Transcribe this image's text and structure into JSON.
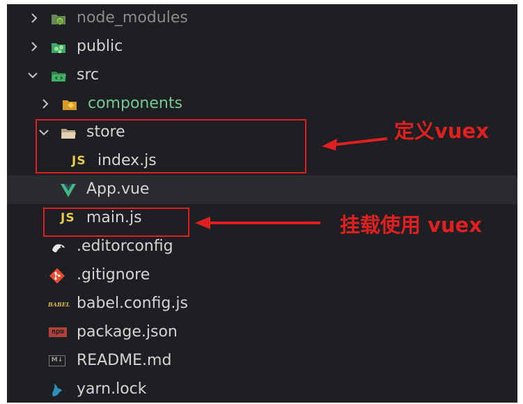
{
  "explorer": {
    "items": [
      {
        "label": "node_modules",
        "icon": "node-modules-folder-icon",
        "type": "folder",
        "expanded": false
      },
      {
        "label": "public",
        "icon": "public-folder-icon",
        "type": "folder",
        "expanded": false
      },
      {
        "label": "src",
        "icon": "src-folder-icon",
        "type": "folder",
        "expanded": true
      },
      {
        "label": "components",
        "icon": "components-folder-icon",
        "type": "folder",
        "expanded": false
      },
      {
        "label": "store",
        "icon": "folder-open-icon",
        "type": "folder",
        "expanded": true
      },
      {
        "label": "index.js",
        "icon": "js-file-icon",
        "icon_text": "JS",
        "type": "file"
      },
      {
        "label": "App.vue",
        "icon": "vue-file-icon",
        "type": "file"
      },
      {
        "label": "main.js",
        "icon": "js-file-icon",
        "icon_text": "JS",
        "type": "file"
      },
      {
        "label": ".editorconfig",
        "icon": "editorconfig-file-icon",
        "type": "file"
      },
      {
        "label": ".gitignore",
        "icon": "git-file-icon",
        "type": "file"
      },
      {
        "label": "babel.config.js",
        "icon": "babel-file-icon",
        "icon_text": "BABEL",
        "type": "file"
      },
      {
        "label": "package.json",
        "icon": "npm-file-icon",
        "icon_text": "npm",
        "type": "file"
      },
      {
        "label": "README.md",
        "icon": "markdown-file-icon",
        "icon_text": "M↓",
        "type": "file"
      },
      {
        "label": "yarn.lock",
        "icon": "yarn-file-icon",
        "type": "file"
      }
    ]
  },
  "annotations": {
    "define_vuex": "定义vuex",
    "mount_use_vuex": "挂载使用 vuex"
  },
  "colors": {
    "background": "#1e1f22",
    "text": "#d4d4d4",
    "components_text": "#73c991",
    "js_icon": "#e6c84a",
    "vue_icon": "#41b883",
    "annotation_red": "#e02020"
  }
}
